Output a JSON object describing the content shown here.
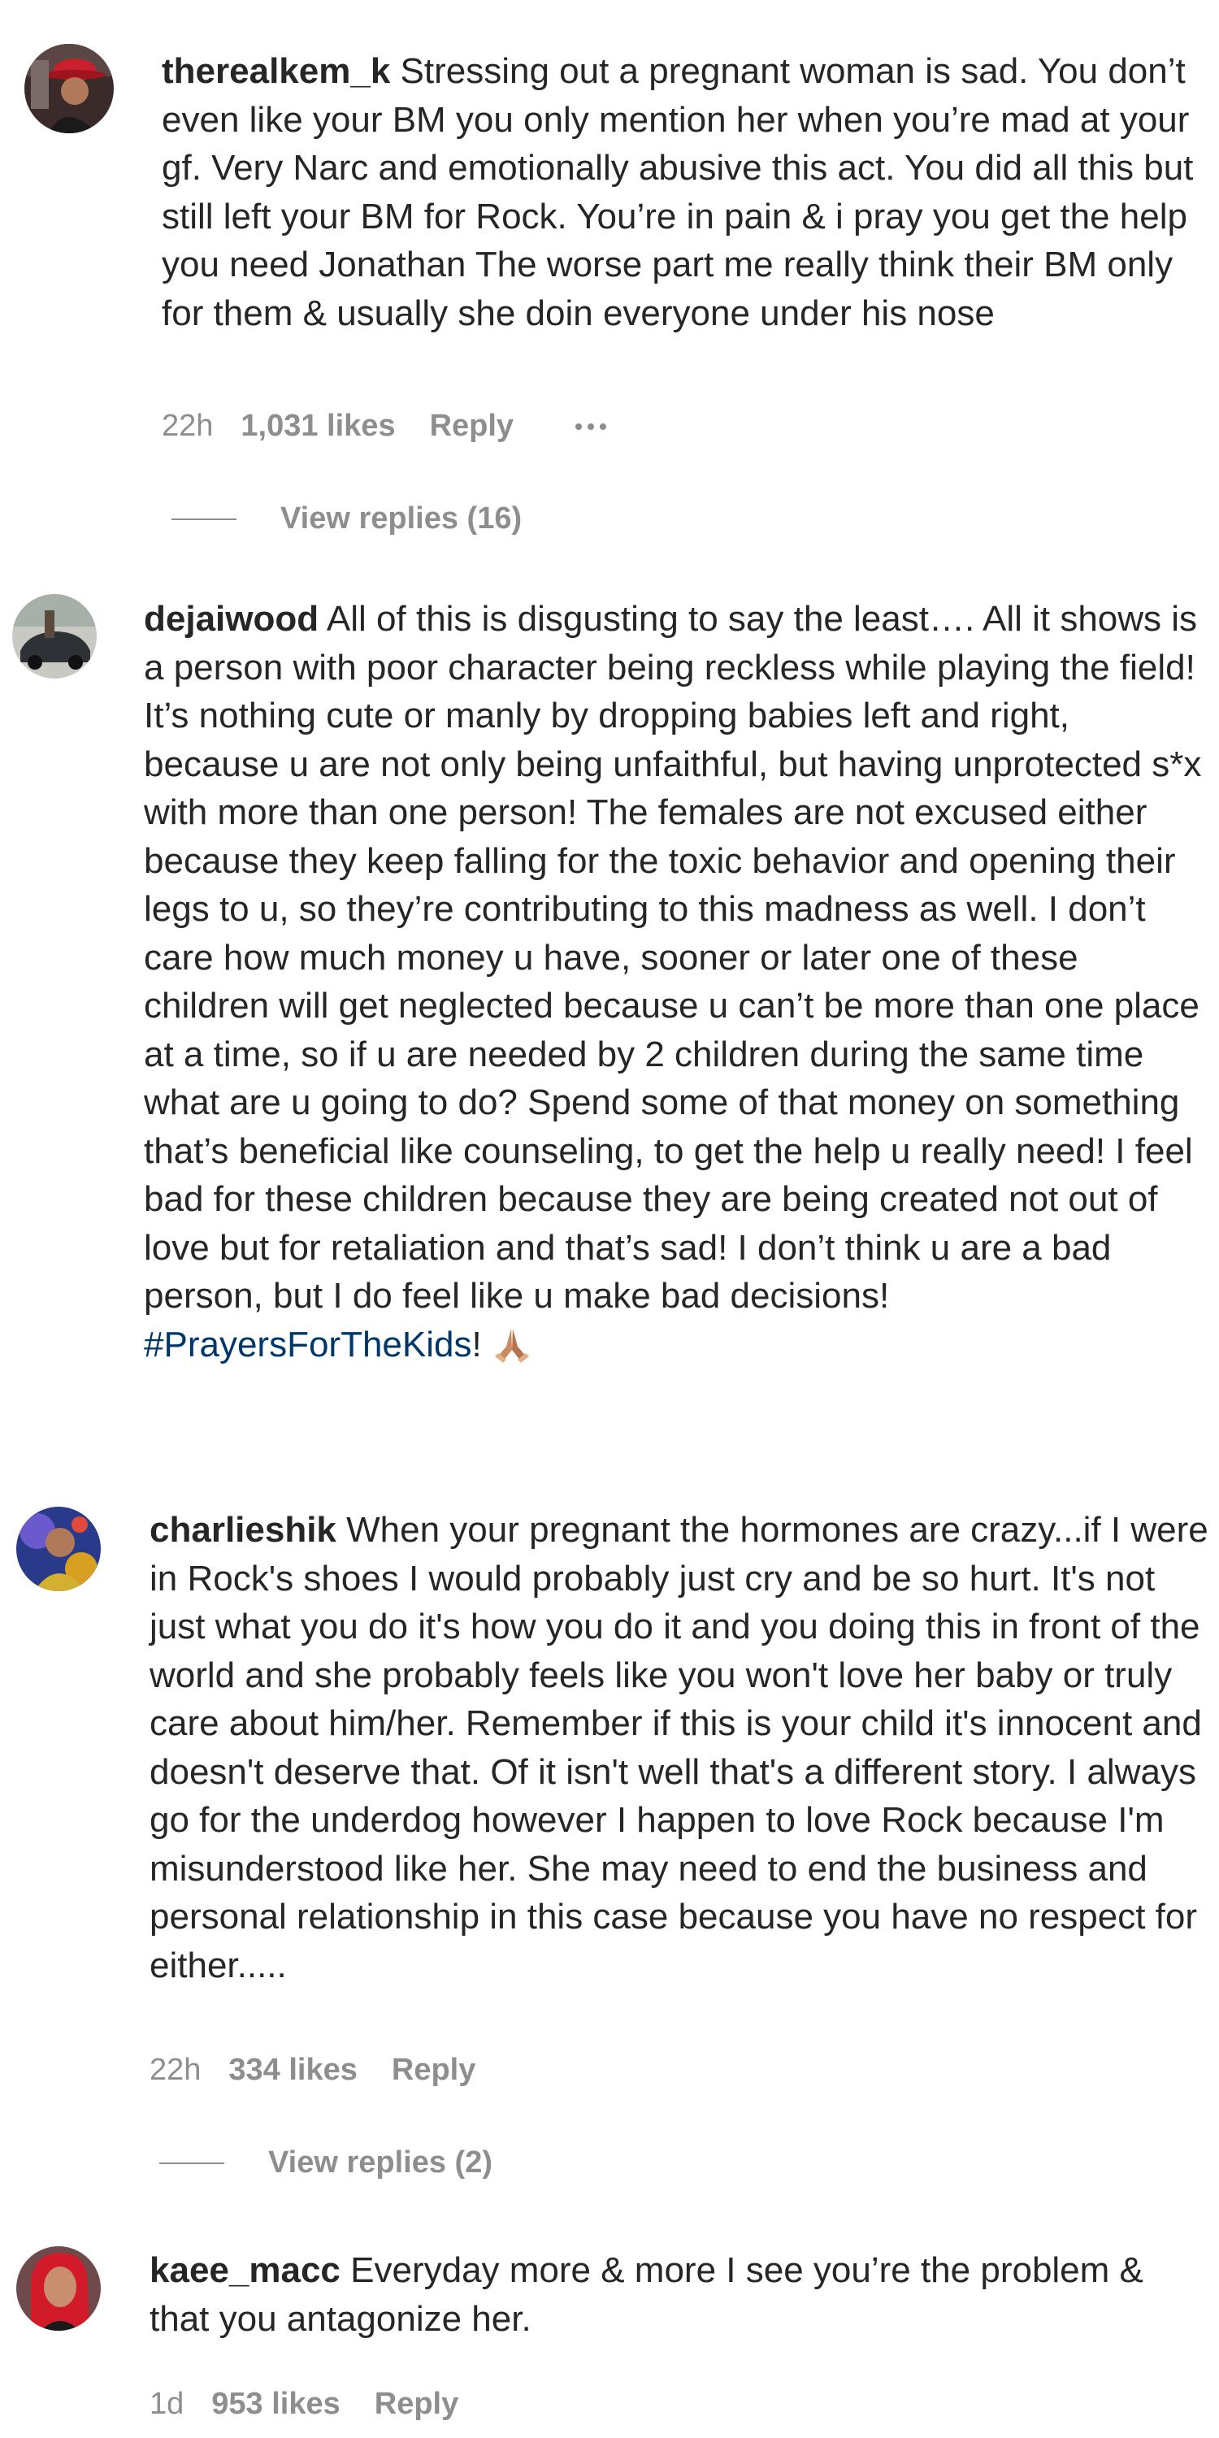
{
  "comments": [
    {
      "username": "therealkem_k",
      "text": "Stressing out a pregnant woman is sad. You don’t even like your BM you only mention her when you’re mad at your gf. Very Narc and emotionally abusive this act. You did all this but still left your BM for Rock. You’re in pain & i pray you get the help you need Jonathan The worse part me really think their BM only for them & usually she doin everyone under his nose",
      "time": "22h",
      "likes": "1,031 likes",
      "reply_label": "Reply",
      "view_replies": "View replies (16)"
    },
    {
      "username": "dejaiwood",
      "text": "All of this is disgusting to say the least…. All it shows is a person with poor character being reckless while playing the field! It’s nothing cute or manly by dropping babies left and right, because u are not only being unfaithful, but having unprotected s*x with more than one person! The females are not excused either because they keep falling for the toxic behavior and opening their legs to u, so they’re contributing to this madness as well. I don’t care how much money u have, sooner or later one of these children will get neglected because u can’t be more than one place at a time, so if u are needed by 2 children during the same time what are u going to do? Spend some of that money on something that’s beneficial like counseling, to get the help u really need! I feel bad for these children because they are being created not out of love but for retaliation and that’s sad! I don’t think u are a bad person, but I do feel like u make bad decisions!",
      "hashtag": "#PrayersForTheKids",
      "after_hashtag": "!",
      "emoji": "praying-hands-emoji"
    },
    {
      "username": "charlieshik",
      "text": "When your pregnant the hormones are crazy...if I were in Rock's shoes I would probably just cry and be so hurt. It's not just what you do it's how you do it and you doing this in front of the world and she probably feels like you won't love her baby or truly care about him/her. Remember if this is your child it's innocent and doesn't deserve that. Of it isn't well that's a different story. I always go for the underdog however I happen to love Rock because I'm misunderstood like her. She may need to end the business and personal relationship in this case because you have no respect for either.....",
      "time": "22h",
      "likes": "334 likes",
      "reply_label": "Reply",
      "view_replies": "View replies (2)"
    },
    {
      "username": "kaee_macc",
      "text": "Everyday more & more I see you’re the problem & that you antagonize her.",
      "time": "1d",
      "likes": "953 likes",
      "reply_label": "Reply"
    }
  ],
  "colors": {
    "text": "#262626",
    "secondary": "#8e8e8e",
    "hashtag": "#00376b",
    "background": "#ffffff"
  }
}
